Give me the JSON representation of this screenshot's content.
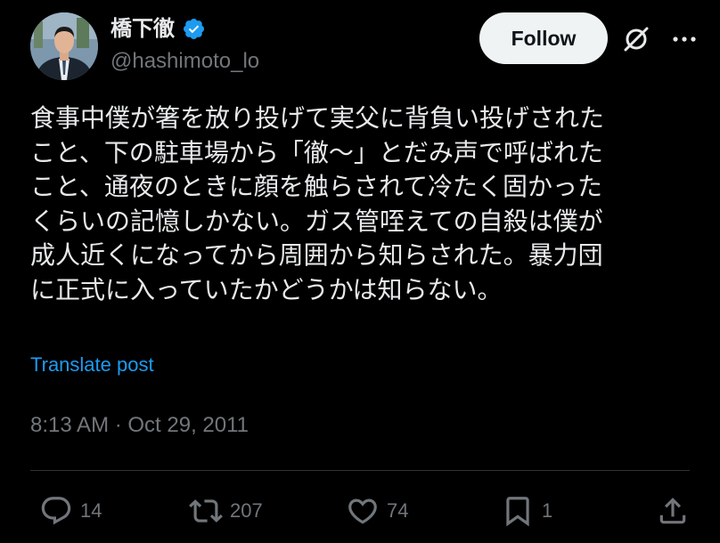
{
  "author": {
    "display_name": "橋下徹",
    "handle": "@hashimoto_lo",
    "verified": true
  },
  "header": {
    "follow_label": "Follow",
    "grok_icon": "grok-icon",
    "more_icon": "more-icon"
  },
  "tweet": {
    "text_lines": [
      "食事中僕が箸を放り投げて実父に背負い投げされた",
      "こと、下の駐車場から「徹〜」とだみ声で呼ばれた",
      "こと、通夜のときに顔を触らされて冷たく固かった",
      "くらいの記憶しかない。ガス管咥えての自殺は僕が",
      "成人近くになってから周囲から知らされた。暴力団",
      "に正式に入っていたかどうかは知らない。"
    ],
    "translate_label": "Translate post",
    "timestamp": "8:13 AM · Oct 29, 2011"
  },
  "actions": {
    "reply_count": "14",
    "retweet_count": "207",
    "like_count": "74",
    "bookmark_count": "1"
  },
  "colors": {
    "background": "#000000",
    "text": "#e7e9ea",
    "muted": "#71767b",
    "accent": "#1d9bf0",
    "verified": "#1d9bf0",
    "divider": "#2f3336",
    "follow_bg": "#eff3f4"
  }
}
